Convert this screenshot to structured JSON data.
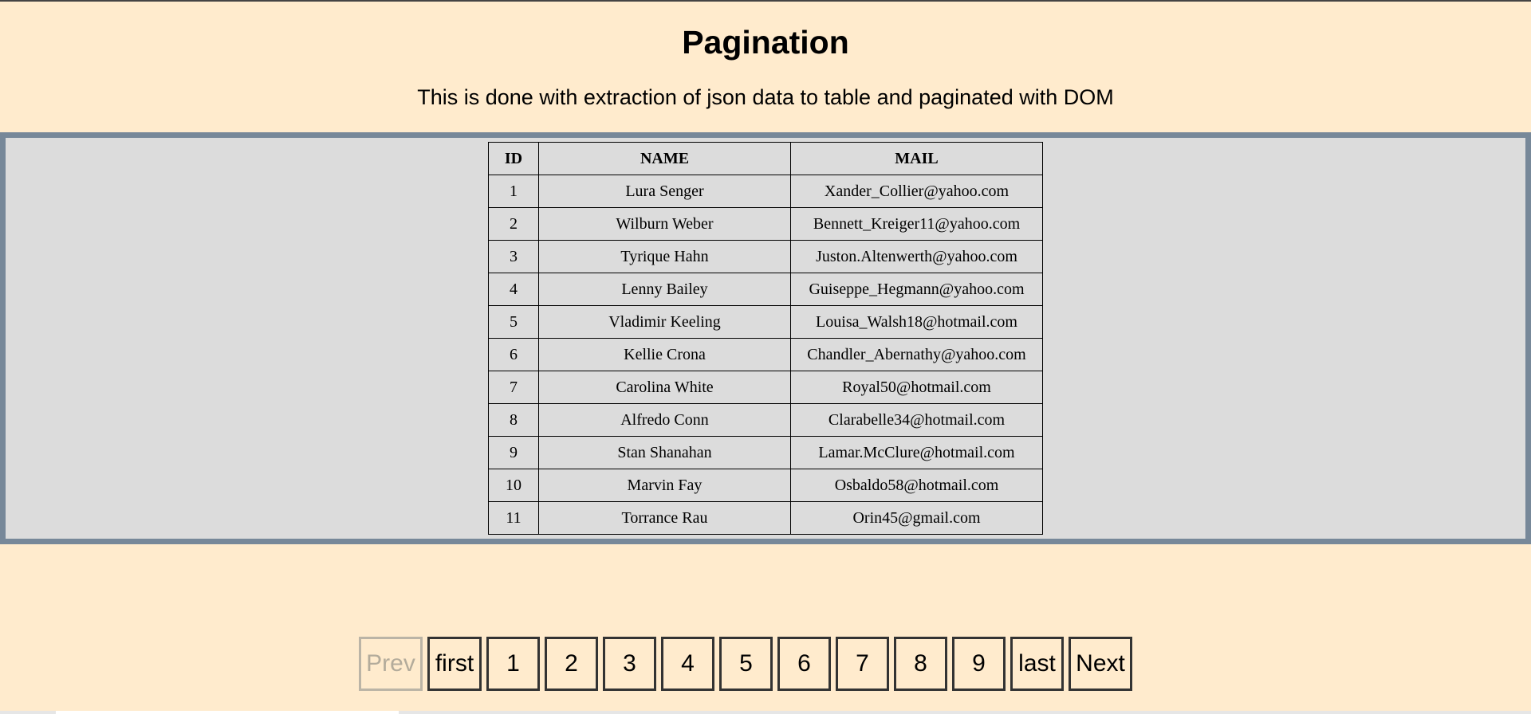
{
  "header": {
    "title": "Pagination",
    "subtitle": "This is done with extraction of json data to table and paginated with DOM"
  },
  "table": {
    "columns": [
      "ID",
      "NAME",
      "MAIL"
    ],
    "rows": [
      [
        "1",
        "Lura Senger",
        "Xander_Collier@yahoo.com"
      ],
      [
        "2",
        "Wilburn Weber",
        "Bennett_Kreiger11@yahoo.com"
      ],
      [
        "3",
        "Tyrique Hahn",
        "Juston.Altenwerth@yahoo.com"
      ],
      [
        "4",
        "Lenny Bailey",
        "Guiseppe_Hegmann@yahoo.com"
      ],
      [
        "5",
        "Vladimir Keeling",
        "Louisa_Walsh18@hotmail.com"
      ],
      [
        "6",
        "Kellie Crona",
        "Chandler_Abernathy@yahoo.com"
      ],
      [
        "7",
        "Carolina White",
        "Royal50@hotmail.com"
      ],
      [
        "8",
        "Alfredo Conn",
        "Clarabelle34@hotmail.com"
      ],
      [
        "9",
        "Stan Shanahan",
        "Lamar.McClure@hotmail.com"
      ],
      [
        "10",
        "Marvin Fay",
        "Osbaldo58@hotmail.com"
      ],
      [
        "11",
        "Torrance Rau",
        "Orin45@gmail.com"
      ]
    ]
  },
  "pagination": {
    "prev": "Prev",
    "first": "first",
    "pages": [
      "1",
      "2",
      "3",
      "4",
      "5",
      "6",
      "7",
      "8",
      "9"
    ],
    "last": "last",
    "next": "Next",
    "prev_disabled": true
  },
  "colors": {
    "page_background": "#ffebcd",
    "panel_background": "#dcdcdc",
    "panel_border": "#778899"
  }
}
